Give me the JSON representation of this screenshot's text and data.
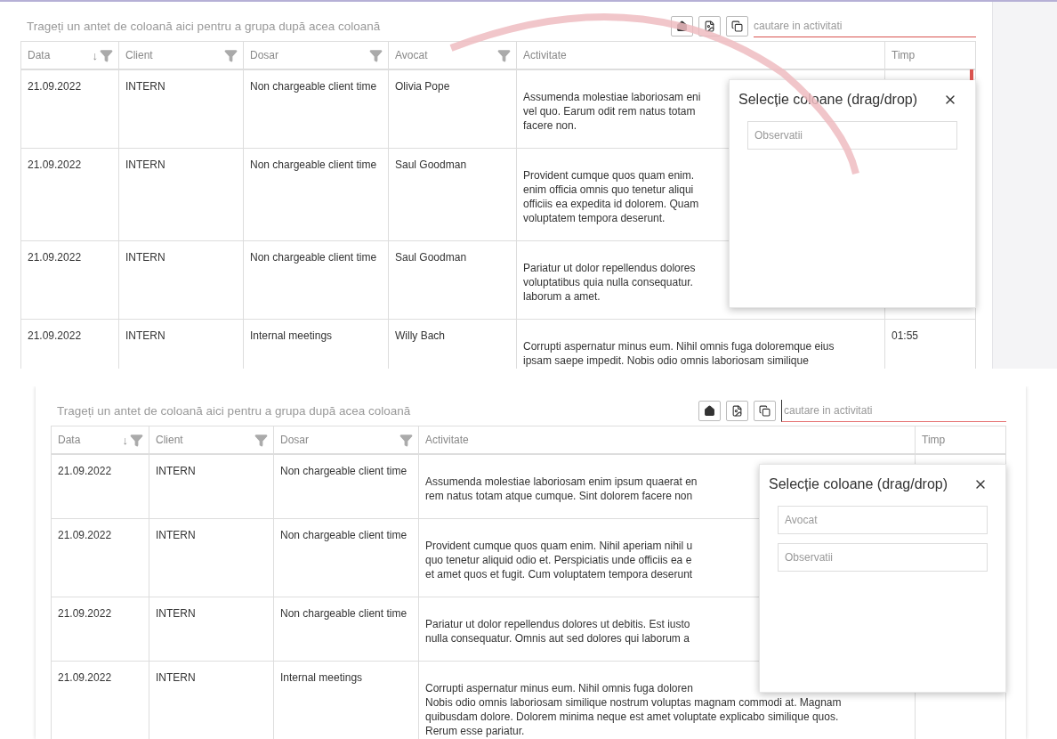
{
  "panels": [
    {
      "group_hint": "Trageți un antet de coloană aici pentru a grupa după acea coloană",
      "search": {
        "placeholder": "cautare in activitati",
        "focused": false
      },
      "annotation": {
        "kind": "drag-arc"
      },
      "columns": [
        {
          "label": "Data",
          "kind": "date",
          "sort_arrow": "↓",
          "filter": true
        },
        {
          "label": "Client",
          "kind": "client",
          "filter": true
        },
        {
          "label": "Dosar",
          "kind": "dosar",
          "filter": true
        },
        {
          "label": "Avocat",
          "kind": "avocat",
          "filter": true
        },
        {
          "label": "Activitate",
          "kind": "activity",
          "filter": false
        },
        {
          "label": "Timp",
          "kind": "time",
          "filter": false
        }
      ],
      "rows": [
        {
          "cells": [
            "21.09.2022",
            "INTERN",
            "Non chargeable client time",
            "Olivia Pope",
            [
              "Assumenda molestiae laboriosam eni",
              "vel quo. Earum odit rem natus totam",
              "facere non."
            ]
          ]
        },
        {
          "cells": [
            "21.09.2022",
            "INTERN",
            "Non chargeable client time",
            "Saul Goodman",
            [
              "Provident cumque quos quam enim.",
              "enim officia omnis quo tenetur aliqui",
              "officiis ea expedita id dolorem. Quam",
              "voluptatem tempora deserunt."
            ]
          ]
        },
        {
          "cells": [
            "21.09.2022",
            "INTERN",
            "Non chargeable client time",
            "Saul Goodman",
            [
              "Pariatur ut dolor repellendus dolores",
              "voluptatibus quia nulla consequatur.",
              "laborum a amet."
            ]
          ]
        },
        {
          "cells": [
            "21.09.2022",
            "INTERN",
            "Internal meetings",
            "Willy Bach",
            [
              "Corrupti aspernatur minus eum. Nihil omnis fuga doloremque eius",
              "ipsam saepe impedit. Nobis odio omnis laboriosam similique"
            ],
            "01:55"
          ]
        }
      ],
      "column_chooser": {
        "title": "Selecție coloane (drag/drop)",
        "items": [
          "Observatii"
        ]
      }
    },
    {
      "group_hint": "Trageți un antet de coloană aici pentru a grupa după acea coloană",
      "search": {
        "placeholder": "cautare in activitati",
        "focused": true
      },
      "annotation": {
        "kind": "none"
      },
      "columns": [
        {
          "label": "Data",
          "kind": "date",
          "sort_arrow": "↓",
          "filter": true
        },
        {
          "label": "Client",
          "kind": "client",
          "filter": true
        },
        {
          "label": "Dosar",
          "kind": "dosar",
          "filter": true
        },
        {
          "label": "Activitate",
          "kind": "activity",
          "filter": false
        },
        {
          "label": "Timp",
          "kind": "time",
          "filter": false
        }
      ],
      "rows": [
        {
          "cells": [
            "21.09.2022",
            "INTERN",
            "Non chargeable client time",
            [
              "Assumenda molestiae laboriosam enim ipsum quaerat en",
              "rem natus totam atque cumque. Sint dolorem facere non"
            ]
          ]
        },
        {
          "cells": [
            "21.09.2022",
            "INTERN",
            "Non chargeable client time",
            [
              "Provident cumque quos quam enim. Nihil aperiam nihil u",
              "quo tenetur aliquid odio et. Perspiciatis unde officiis ea e",
              "et amet quos et fugit. Cum voluptatem tempora deserunt"
            ]
          ]
        },
        {
          "cells": [
            "21.09.2022",
            "INTERN",
            "Non chargeable client time",
            [
              "Pariatur ut dolor repellendus dolores ut debitis. Est iusto",
              "nulla consequatur. Omnis aut sed dolores qui laborum a"
            ]
          ]
        },
        {
          "cells": [
            "21.09.2022",
            "INTERN",
            "Internal meetings",
            [
              "Corrupti aspernatur minus eum. Nihil omnis fuga doloren",
              "Nobis odio omnis laboriosam similique nostrum voluptas magnam commodi at. Magnam",
              "quibusdam dolore. Dolorem minima neque est amet voluptate explicabo similique quos.",
              "Rerum esse pariatur."
            ]
          ]
        }
      ],
      "column_chooser": {
        "title": "Selecție coloane (drag/drop)",
        "items": [
          "Avocat",
          "Observatii"
        ]
      }
    }
  ]
}
